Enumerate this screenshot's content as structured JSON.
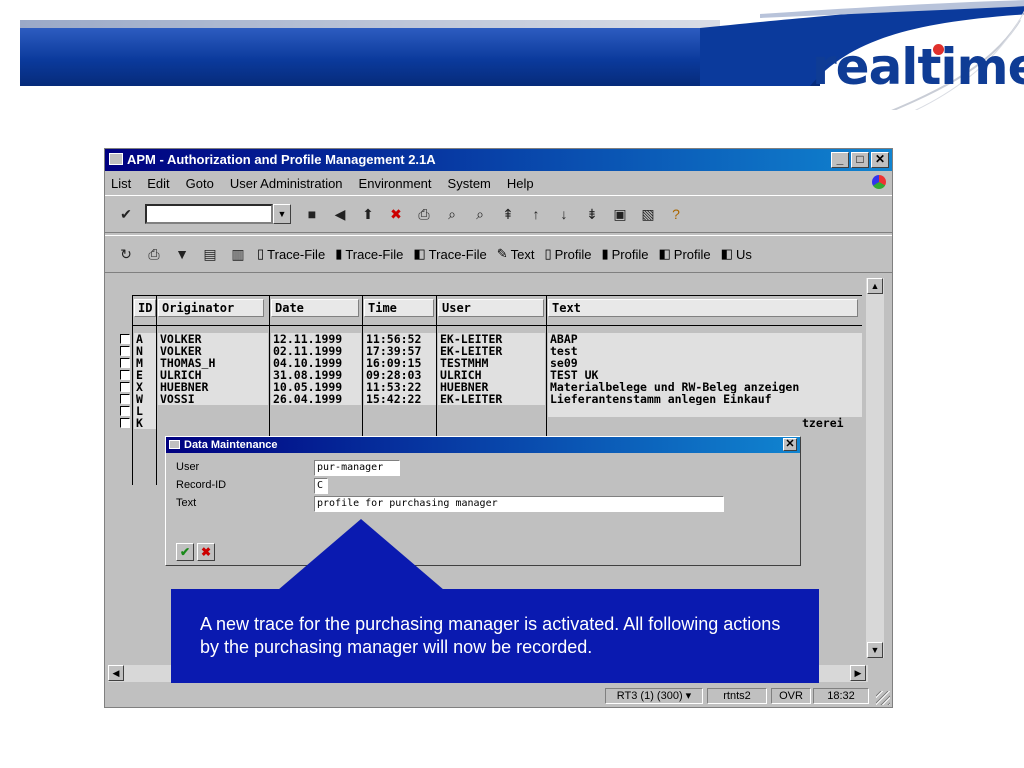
{
  "slide": {
    "logo_text": "realtime"
  },
  "window": {
    "title": "APM - Authorization and Profile Management 2.1A",
    "controls": [
      "_",
      "□",
      "✕"
    ]
  },
  "menu": [
    "List",
    "Edit",
    "Goto",
    "User Administration",
    "Environment",
    "System",
    "Help"
  ],
  "toolbar2": {
    "buttons": [
      "Trace-File",
      "Trace-File",
      "Trace-File",
      "Text",
      "Profile",
      "Profile",
      "Profile",
      "Us"
    ]
  },
  "table": {
    "headers": [
      "ID",
      "Originator",
      "Date",
      "Time",
      "User",
      "Text"
    ],
    "rows": [
      {
        "id": "A",
        "originator": "VOLKER",
        "date": "12.11.1999",
        "time": "11:56:52",
        "user": "EK-LEITER",
        "text": "ABAP"
      },
      {
        "id": "N",
        "originator": "VOLKER",
        "date": "02.11.1999",
        "time": "17:39:57",
        "user": "EK-LEITER",
        "text": "test"
      },
      {
        "id": "M",
        "originator": "THOMAS_H",
        "date": "04.10.1999",
        "time": "16:09:15",
        "user": "TESTMHM",
        "text": "se09"
      },
      {
        "id": "E",
        "originator": "ULRICH",
        "date": "31.08.1999",
        "time": "09:28:03",
        "user": "ULRICH",
        "text": "TEST UK"
      },
      {
        "id": "X",
        "originator": "HUEBNER",
        "date": "10.05.1999",
        "time": "11:53:22",
        "user": "HUEBNER",
        "text": "Materialbelege und RW-Beleg anzeigen"
      },
      {
        "id": "W",
        "originator": "VOSSI",
        "date": "26.04.1999",
        "time": "15:42:22",
        "user": "EK-LEITER",
        "text": "Lieferantenstamm anlegen Einkauf"
      },
      {
        "id": "L",
        "originator": "",
        "date": "",
        "time": "",
        "user": "",
        "text": ""
      },
      {
        "id": "K",
        "originator": "",
        "date": "",
        "time": "",
        "user": "",
        "text": "tzerei"
      }
    ]
  },
  "popup": {
    "title": "Data Maintenance",
    "labels": {
      "user": "User",
      "record": "Record-ID",
      "text": "Text"
    },
    "values": {
      "user": "pur-manager",
      "record": "C",
      "text": "profile for purchasing manager"
    },
    "ok_icon": "✔",
    "cancel_icon": "✖"
  },
  "status": {
    "system": "RT3 (1) (300)",
    "server": "rtnts2",
    "mode": "OVR",
    "time": "18:32"
  },
  "callout": {
    "text": "A new trace for the purchasing manager is activated. All following actions by the purchasing manager will now be recorded."
  },
  "colors": {
    "header_band": "#0b3a9c",
    "logo": "#0f3c95",
    "callout": "#0a1ab0",
    "titlebar": "#000080"
  }
}
